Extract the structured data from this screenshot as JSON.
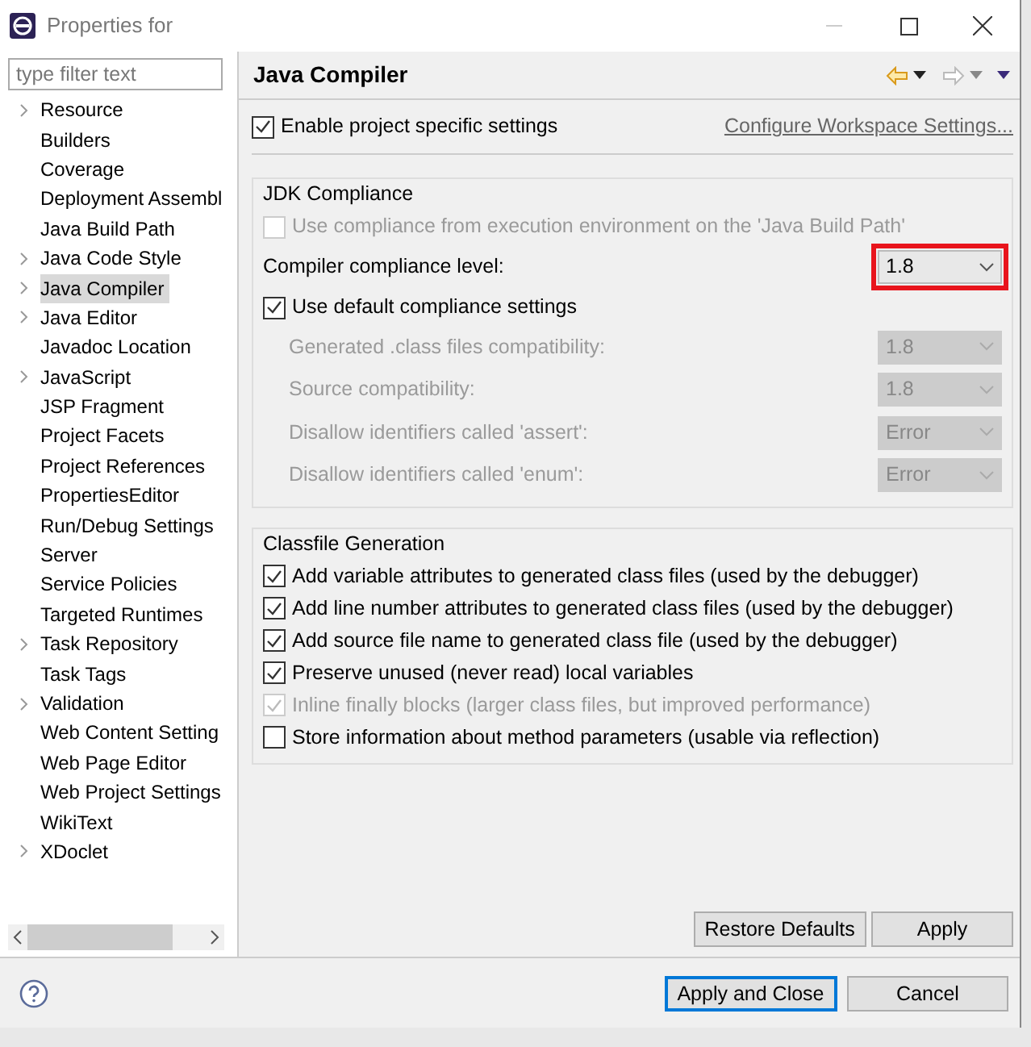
{
  "window": {
    "title": "Properties for"
  },
  "filter": {
    "placeholder": "type filter text"
  },
  "tree": [
    {
      "label": "Resource",
      "expandable": true,
      "selected": false
    },
    {
      "label": "Builders",
      "expandable": false,
      "selected": false
    },
    {
      "label": "Coverage",
      "expandable": false,
      "selected": false
    },
    {
      "label": "Deployment Assembl",
      "expandable": false,
      "selected": false
    },
    {
      "label": "Java Build Path",
      "expandable": false,
      "selected": false
    },
    {
      "label": "Java Code Style",
      "expandable": true,
      "selected": false
    },
    {
      "label": "Java Compiler",
      "expandable": true,
      "selected": true
    },
    {
      "label": "Java Editor",
      "expandable": true,
      "selected": false
    },
    {
      "label": "Javadoc Location",
      "expandable": false,
      "selected": false
    },
    {
      "label": "JavaScript",
      "expandable": true,
      "selected": false
    },
    {
      "label": "JSP Fragment",
      "expandable": false,
      "selected": false
    },
    {
      "label": "Project Facets",
      "expandable": false,
      "selected": false
    },
    {
      "label": "Project References",
      "expandable": false,
      "selected": false
    },
    {
      "label": "PropertiesEditor",
      "expandable": false,
      "selected": false
    },
    {
      "label": "Run/Debug Settings",
      "expandable": false,
      "selected": false
    },
    {
      "label": "Server",
      "expandable": false,
      "selected": false
    },
    {
      "label": "Service Policies",
      "expandable": false,
      "selected": false
    },
    {
      "label": "Targeted Runtimes",
      "expandable": false,
      "selected": false
    },
    {
      "label": "Task Repository",
      "expandable": true,
      "selected": false
    },
    {
      "label": "Task Tags",
      "expandable": false,
      "selected": false
    },
    {
      "label": "Validation",
      "expandable": true,
      "selected": false
    },
    {
      "label": "Web Content Setting",
      "expandable": false,
      "selected": false
    },
    {
      "label": "Web Page Editor",
      "expandable": false,
      "selected": false
    },
    {
      "label": "Web Project Settings",
      "expandable": false,
      "selected": false
    },
    {
      "label": "WikiText",
      "expandable": false,
      "selected": false
    },
    {
      "label": "XDoclet",
      "expandable": true,
      "selected": false
    }
  ],
  "page": {
    "title": "Java Compiler",
    "enable": {
      "label": "Enable project specific settings",
      "checked": true
    },
    "link": "Configure Workspace Settings..."
  },
  "jdk": {
    "legend": "JDK Compliance",
    "use_env": {
      "label": "Use compliance from execution environment on the 'Java Build Path'",
      "checked": false,
      "disabled": true
    },
    "level": {
      "label": "Compiler compliance level:",
      "value": "1.8",
      "highlighted": true
    },
    "use_default": {
      "label": "Use default compliance settings",
      "checked": true
    },
    "options": [
      {
        "label": "Generated .class files compatibility:",
        "value": "1.8",
        "disabled": true
      },
      {
        "label": "Source compatibility:",
        "value": "1.8",
        "disabled": true
      },
      {
        "label": "Disallow identifiers called 'assert':",
        "value": "Error",
        "disabled": true
      },
      {
        "label": "Disallow identifiers called 'enum':",
        "value": "Error",
        "disabled": true
      }
    ]
  },
  "classfile": {
    "legend": "Classfile Generation",
    "options": [
      {
        "label": "Add variable attributes to generated class files (used by the debugger)",
        "checked": true,
        "disabled": false
      },
      {
        "label": "Add line number attributes to generated class files (used by the debugger)",
        "checked": true,
        "disabled": false
      },
      {
        "label": "Add source file name to generated class file (used by the debugger)",
        "checked": true,
        "disabled": false
      },
      {
        "label": "Preserve unused (never read) local variables",
        "checked": true,
        "disabled": false
      },
      {
        "label": "Inline finally blocks (larger class files, but improved performance)",
        "checked": true,
        "disabled": true
      },
      {
        "label": "Store information about method parameters (usable via reflection)",
        "checked": false,
        "disabled": false
      }
    ]
  },
  "page_buttons": [
    "Restore Defaults",
    "Apply"
  ],
  "footer_buttons": [
    {
      "label": "Apply and Close",
      "default": true
    },
    {
      "label": "Cancel",
      "default": false
    }
  ]
}
